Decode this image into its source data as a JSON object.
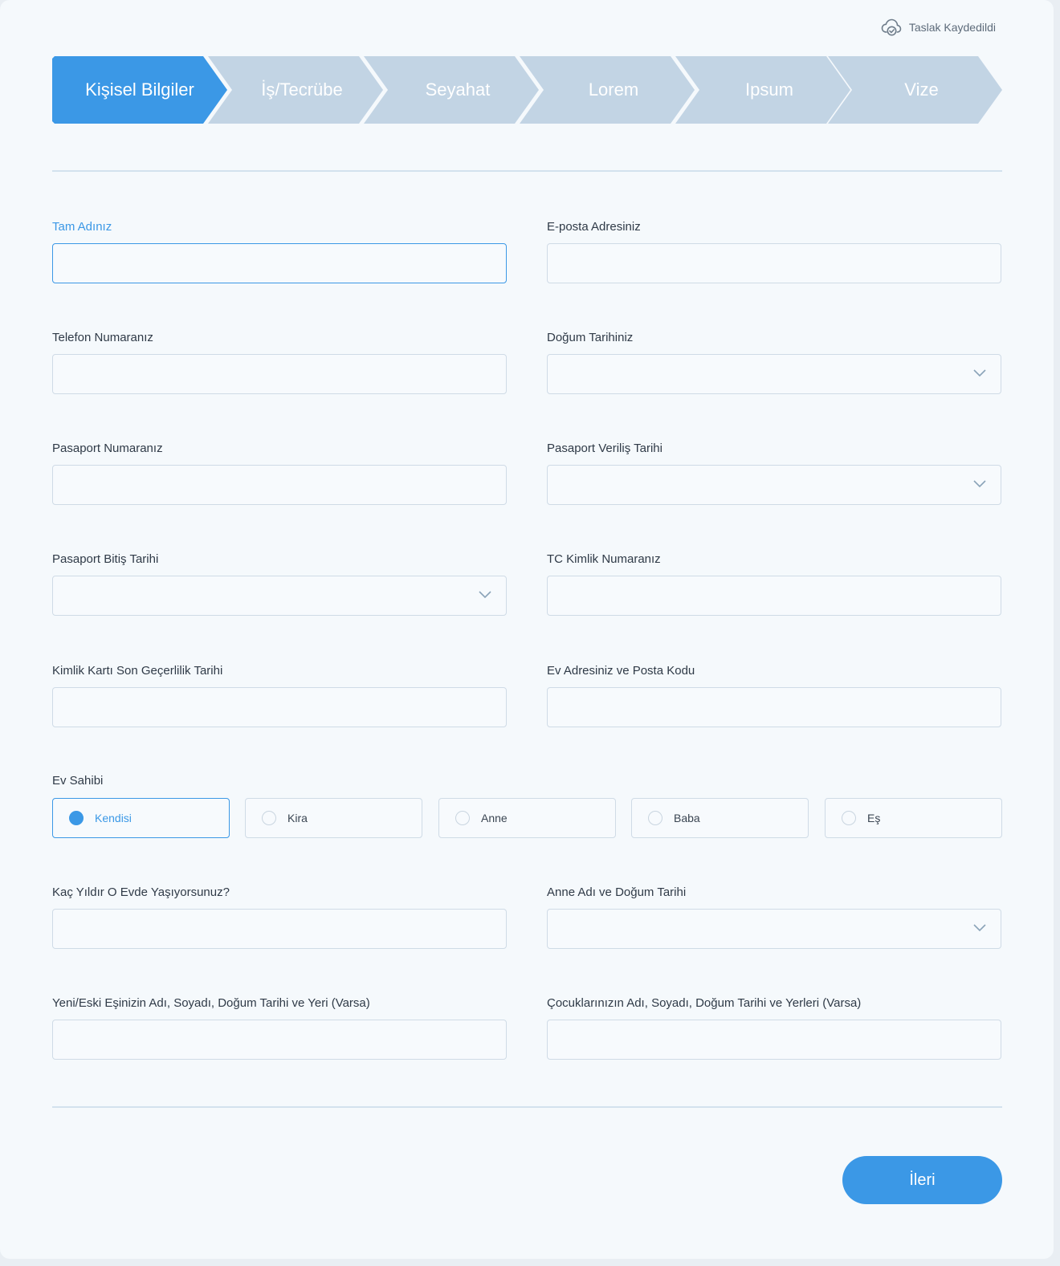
{
  "header": {
    "draft_status": "Taslak Kaydedildi",
    "draft_icon": "cloud-check-icon"
  },
  "steps": [
    {
      "label": "Kişisel Bilgiler",
      "active": true
    },
    {
      "label": "İş/Tecrübe",
      "active": false
    },
    {
      "label": "Seyahat",
      "active": false
    },
    {
      "label": "Lorem",
      "active": false
    },
    {
      "label": "Ipsum",
      "active": false
    },
    {
      "label": "Vize",
      "active": false
    }
  ],
  "form": {
    "full_name": {
      "label": "Tam Adınız",
      "value": ""
    },
    "email": {
      "label": "E-posta Adresiniz",
      "value": ""
    },
    "phone": {
      "label": "Telefon Numaranız",
      "value": ""
    },
    "birth_date": {
      "label": "Doğum Tarihiniz",
      "value": ""
    },
    "passport_number": {
      "label": "Pasaport Numaranız",
      "value": ""
    },
    "passport_issue_date": {
      "label": "Pasaport Veriliş Tarihi",
      "value": ""
    },
    "passport_expiry_date": {
      "label": "Pasaport Bitiş Tarihi",
      "value": ""
    },
    "tc_number": {
      "label": "TC Kimlik Numaranız",
      "value": ""
    },
    "id_expiry": {
      "label": "Kimlik Kartı Son Geçerlilik Tarihi",
      "value": ""
    },
    "home_address": {
      "label": "Ev Adresiniz ve Posta Kodu",
      "value": ""
    },
    "homeowner": {
      "label": "Ev Sahibi",
      "options": [
        "Kendisi",
        "Kira",
        "Anne",
        "Baba",
        "Eş"
      ],
      "selected": "Kendisi"
    },
    "years_at_home": {
      "label": "Kaç Yıldır O Evde Yaşıyorsunuz?",
      "value": ""
    },
    "mother_info": {
      "label": "Anne Adı ve Doğum Tarihi",
      "value": ""
    },
    "spouse_info": {
      "label": "Yeni/Eski Eşinizin Adı, Soyadı, Doğum Tarihi ve Yeri (Varsa)",
      "value": ""
    },
    "children_info": {
      "label": "Çocuklarınızın Adı, Soyadı, Doğum Tarihi ve Yerleri (Varsa)",
      "value": ""
    }
  },
  "footer": {
    "next_label": "İleri"
  },
  "colors": {
    "accent": "#3b98e6",
    "step_inactive": "#c2d4e4",
    "background": "#f5f9fc"
  }
}
